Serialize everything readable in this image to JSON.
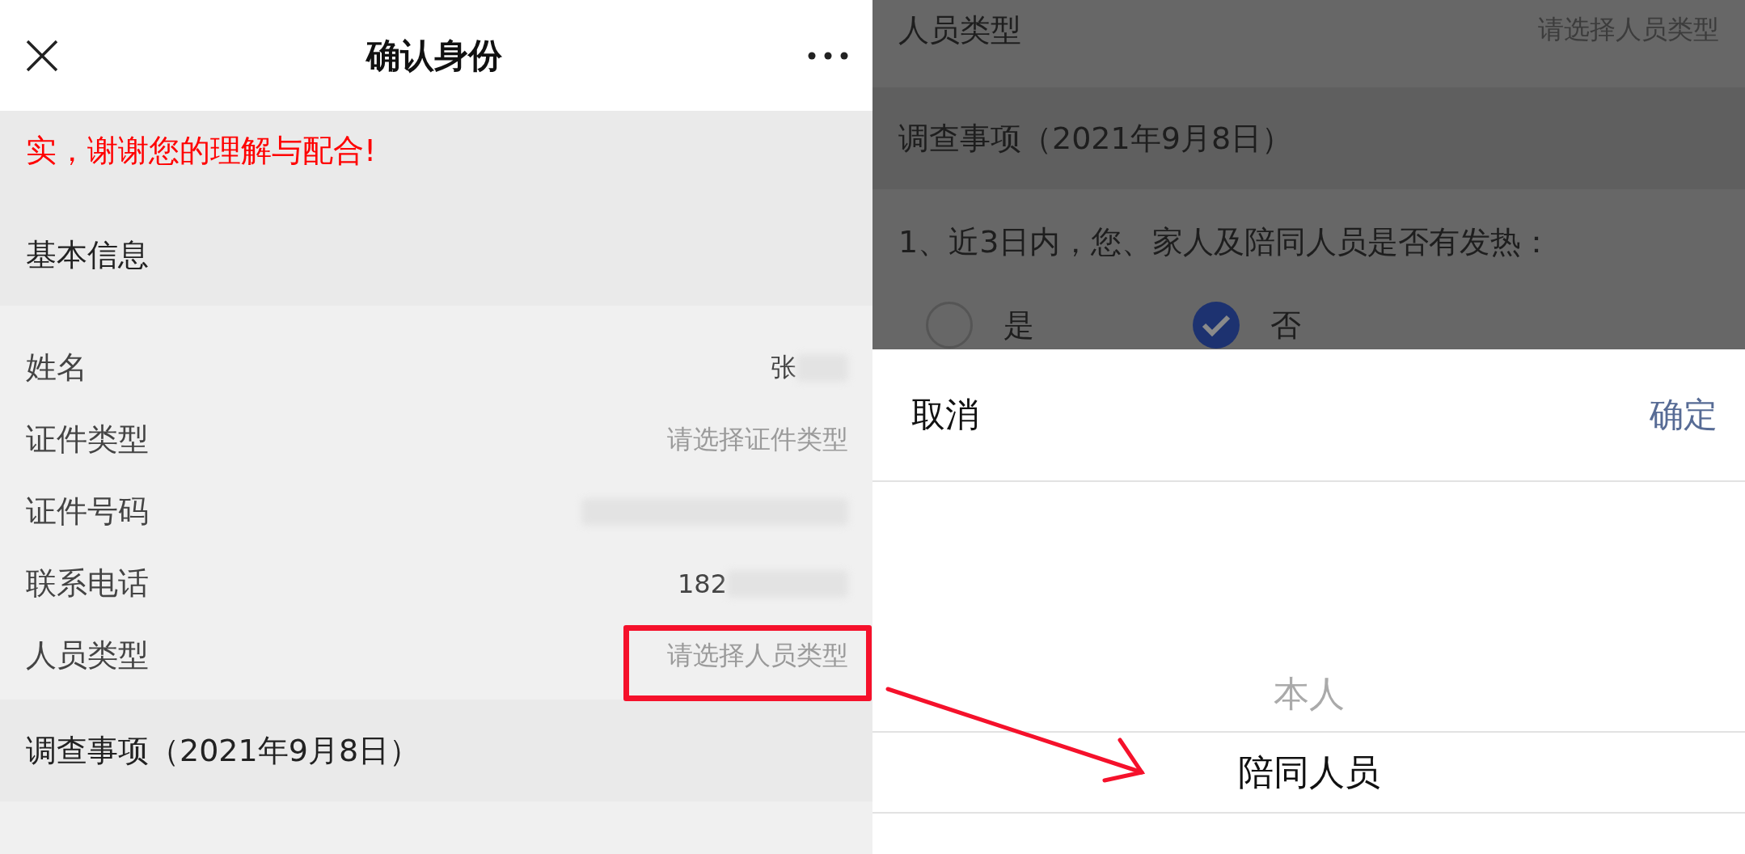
{
  "left_screen": {
    "header": {
      "title": "确认身份"
    },
    "notice": "实，谢谢您的理解与配合!",
    "section_basic": "基本信息",
    "fields": [
      {
        "label": "姓名",
        "value": "张",
        "redacted": true
      },
      {
        "label": "证件类型",
        "placeholder": "请选择证件类型"
      },
      {
        "label": "证件号码",
        "redacted": true
      },
      {
        "label": "联系电话",
        "value": "182",
        "redacted": true
      },
      {
        "label": "人员类型",
        "placeholder": "请选择人员类型",
        "highlighted": true
      }
    ],
    "section_survey": "调查事项（2021年9月8日）"
  },
  "right_screen": {
    "field": {
      "label": "人员类型",
      "placeholder": "请选择人员类型"
    },
    "section": "调查事项（2021年9月8日）",
    "question": "1、近3日内，您、家人及陪同人员是否有发热：",
    "options": [
      {
        "label": "是",
        "selected": false
      },
      {
        "label": "否",
        "selected": true
      }
    ],
    "picker": {
      "cancel": "取消",
      "confirm": "确定",
      "options": [
        {
          "label": "本人",
          "selected": false
        },
        {
          "label": "陪同人员",
          "selected": true
        }
      ]
    }
  }
}
